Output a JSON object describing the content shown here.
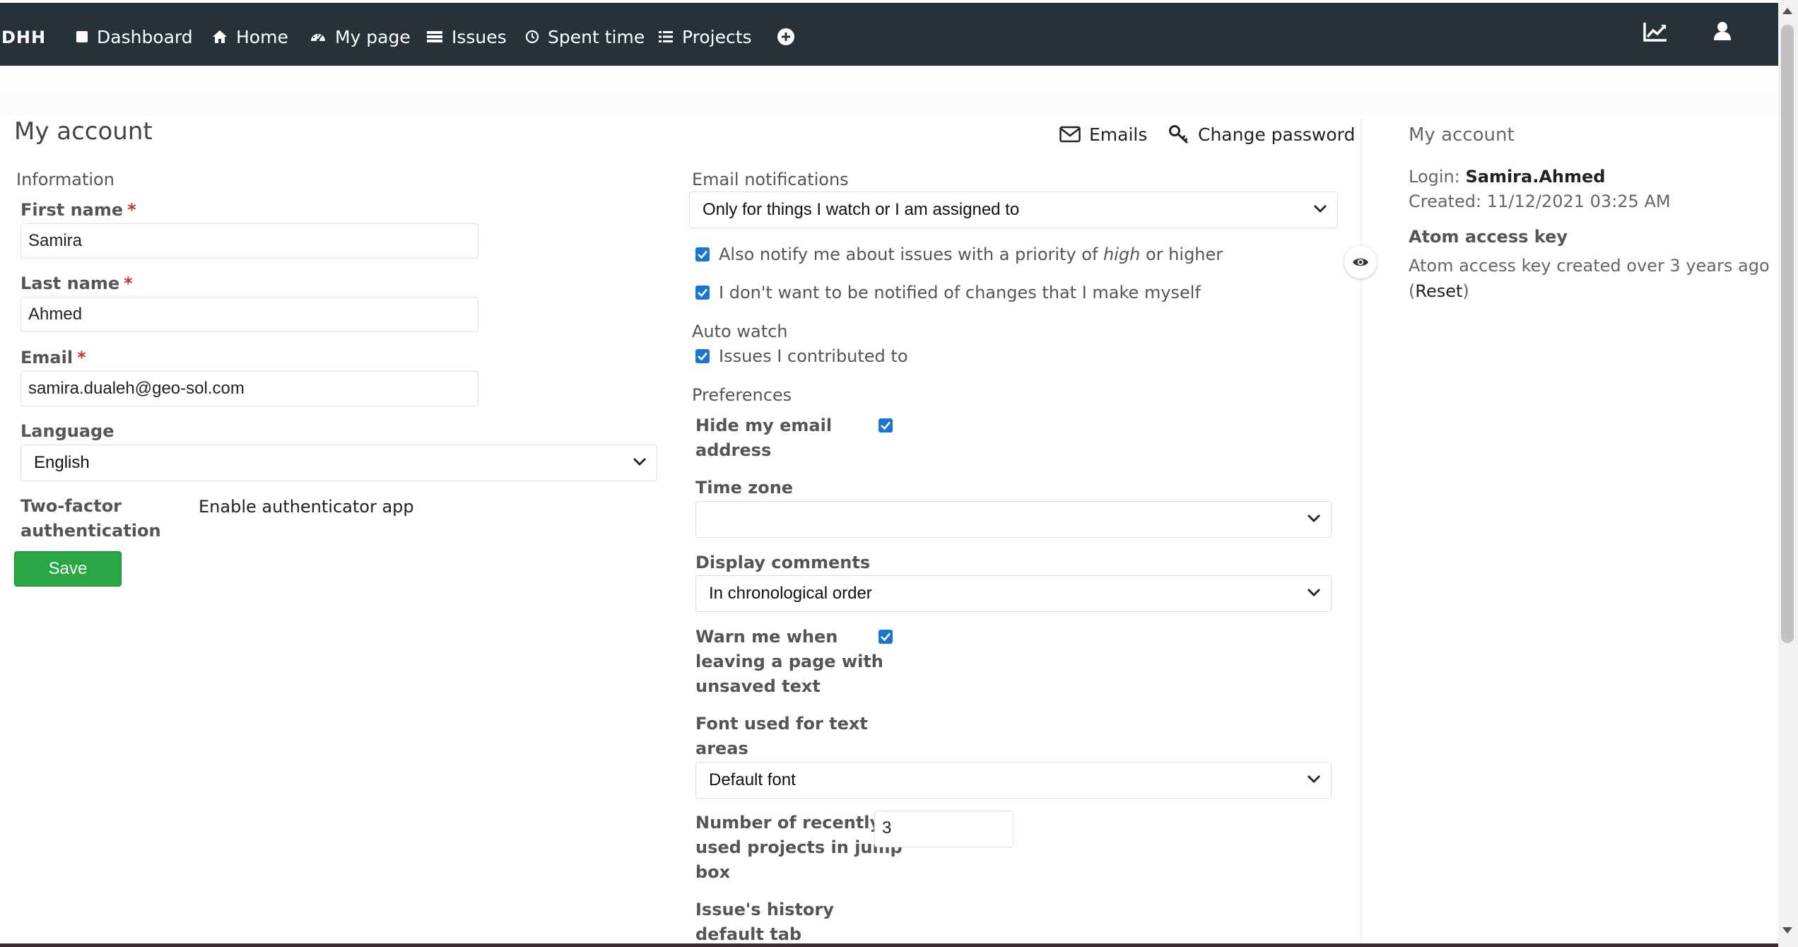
{
  "topbar": {
    "brand": "DHH",
    "nav": [
      {
        "label": "Dashboard",
        "icon": "square-icon"
      },
      {
        "label": "Home",
        "icon": "home-icon"
      },
      {
        "label": "My page",
        "icon": "dashboard-gauge-icon"
      },
      {
        "label": "Issues",
        "icon": "issues-list-icon"
      },
      {
        "label": "Spent time",
        "icon": "clock-icon"
      },
      {
        "label": "Projects",
        "icon": "projects-list-icon"
      }
    ],
    "add_icon": "plus-circle-icon",
    "right_icons": [
      "activity-chart-icon",
      "user-icon"
    ],
    "bg_color": "#263238"
  },
  "page": {
    "title": "My account",
    "actions": {
      "emails": "Emails",
      "change_password": "Change password"
    }
  },
  "information": {
    "legend": "Information",
    "first_name": {
      "label": "First name",
      "required": "*",
      "value": "Samira"
    },
    "last_name": {
      "label": "Last name",
      "required": "*",
      "value": "Ahmed"
    },
    "email": {
      "label": "Email",
      "required": "*",
      "value": "samira.dualeh@geo-sol.com"
    },
    "language": {
      "label": "Language",
      "value": "English"
    },
    "two_factor": {
      "label_line1": "Two-factor",
      "label_line2": "authentication",
      "value": "Enable authenticator app"
    },
    "save_label": "Save",
    "save_color": "#28a745"
  },
  "notifications": {
    "legend": "Email notifications",
    "select_value": "Only for things I watch or I am assigned to",
    "priority": {
      "prefix": "Also notify me about issues with a priority of ",
      "emph": "high",
      "suffix": " or higher",
      "checked": true
    },
    "no_self": {
      "label": "I don't want to be notified of changes that I make myself",
      "checked": true
    }
  },
  "auto_watch": {
    "legend": "Auto watch",
    "contributed": {
      "label": "Issues I contributed to",
      "checked": true
    }
  },
  "preferences": {
    "legend": "Preferences",
    "hide_email": {
      "line1": "Hide my email",
      "line2": "address",
      "checked": true
    },
    "time_zone": {
      "label": "Time zone",
      "value": ""
    },
    "display_comments": {
      "label": "Display comments",
      "value": "In chronological order"
    },
    "warn_unsaved": {
      "line1": "Warn me when",
      "line2": "leaving a page with",
      "line3": "unsaved text",
      "checked": true
    },
    "font": {
      "line1": "Font used for text",
      "line2": "areas",
      "value": "Default font"
    },
    "recent_projects": {
      "line1": "Number of recently",
      "line2": "used projects in jump",
      "line3": "box",
      "value": "3"
    },
    "history_tab": {
      "line1": "Issue's history",
      "line2": "default tab"
    }
  },
  "sidebar": {
    "title": "My account",
    "login_label": "Login: ",
    "login_value": "Samira.Ahmed",
    "created": "Created: 11/12/2021 03:25 AM",
    "atom_heading": "Atom access key",
    "atom_text": "Atom access key created over 3 years ago",
    "reset_open": "(",
    "reset_link": "Reset",
    "reset_close": ")",
    "eye_icon": "eye-icon"
  },
  "accent_color": "#1976d2"
}
